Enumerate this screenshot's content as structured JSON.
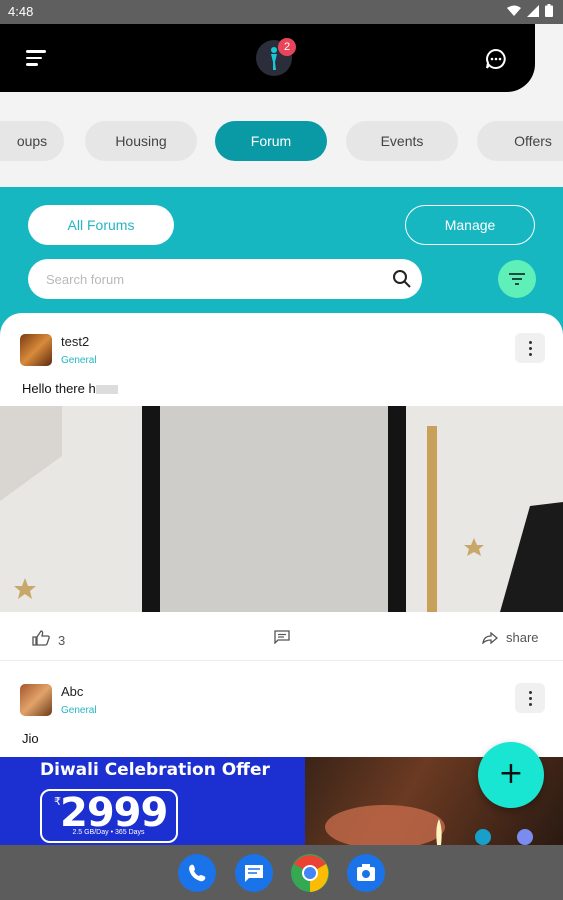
{
  "status_bar": {
    "time": "4:48"
  },
  "header": {
    "notification_count": "2"
  },
  "tabs": [
    {
      "label": "oups"
    },
    {
      "label": "Housing"
    },
    {
      "label": "Forum"
    },
    {
      "label": "Events"
    },
    {
      "label": "Offers"
    }
  ],
  "forum": {
    "all_forums_label": "All Forums",
    "manage_label": "Manage",
    "search_placeholder": "Search forum"
  },
  "posts": [
    {
      "author": "test2",
      "category": "General",
      "text": "Hello there h",
      "likes": "3",
      "share_label": "share"
    },
    {
      "author": "Abc",
      "category": "General",
      "text": "Jio"
    }
  ],
  "banner": {
    "title": "Diwali Celebration Offer",
    "currency": "₹",
    "price": "2999",
    "validity": "2.5 GB/Day • 365 Days"
  },
  "colors": {
    "accent": "#17b7c2",
    "active_tab": "#0a9aa6",
    "fab": "#19e6d2",
    "filter_button": "#5ef0b8",
    "badge": "#e8455a"
  },
  "icons": [
    "menu-icon",
    "chat-icon",
    "search-icon",
    "filter-icon",
    "more-vert-icon",
    "thumb-up-icon",
    "comment-icon",
    "share-icon",
    "add-icon"
  ],
  "dock": [
    "phone-app-icon",
    "messages-app-icon",
    "chrome-app-icon",
    "camera-app-icon"
  ]
}
